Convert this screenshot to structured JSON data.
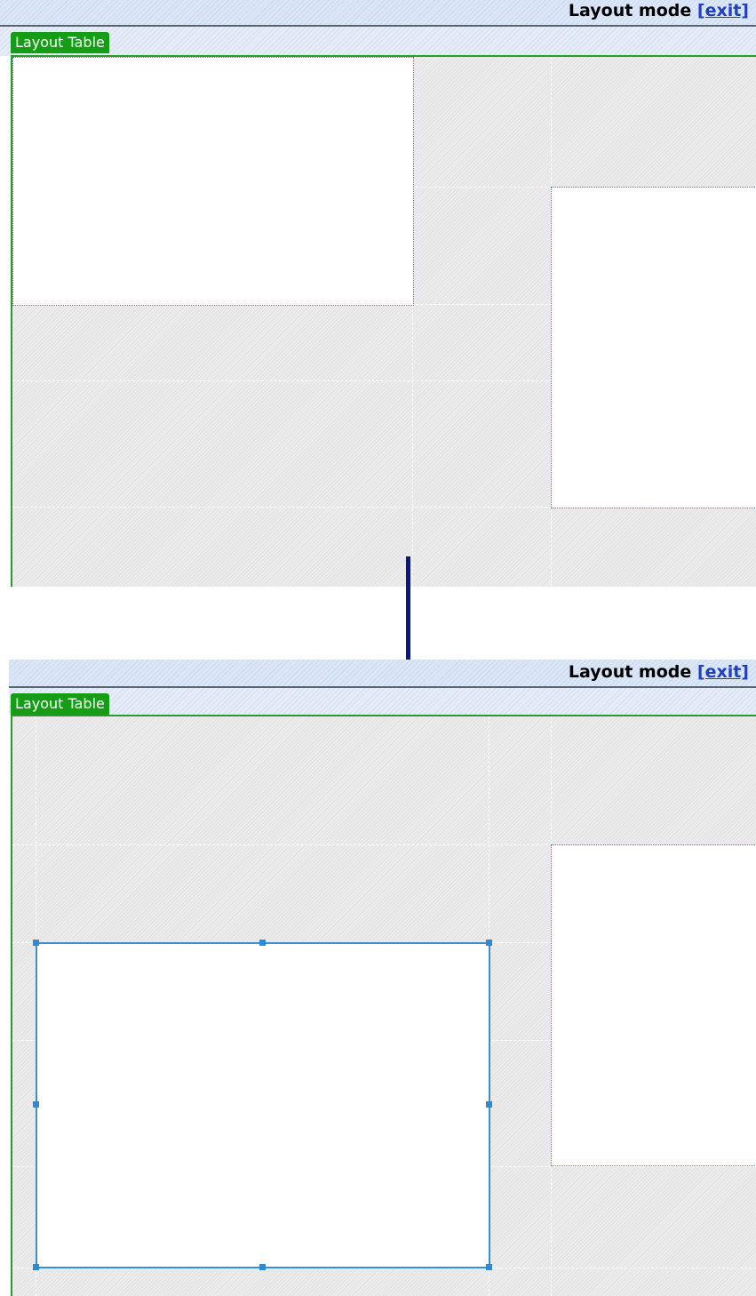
{
  "screens": {
    "before": {
      "mode_label": "Layout mode",
      "exit_label": "[exit]",
      "tab_label": "Layout Table"
    },
    "after": {
      "mode_label": "Layout mode",
      "exit_label": "[exit]",
      "tab_label": "Layout Table"
    }
  },
  "colors": {
    "layout_tab": "#169c16",
    "table_border": "#2a9a2a",
    "cell_outline": "#3a83b8",
    "selection_outline": "#3a8fd0",
    "arrow": "#0c1580",
    "exit_link": "#1f3fbf"
  },
  "icons": {
    "transition": "down-arrow-icon"
  }
}
